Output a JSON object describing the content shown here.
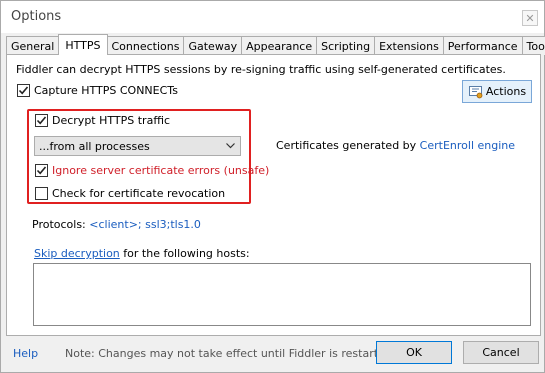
{
  "window": {
    "title": "Options"
  },
  "tabs": [
    {
      "label": "General"
    },
    {
      "label": "HTTPS"
    },
    {
      "label": "Connections"
    },
    {
      "label": "Gateway"
    },
    {
      "label": "Appearance"
    },
    {
      "label": "Scripting"
    },
    {
      "label": "Extensions"
    },
    {
      "label": "Performance"
    },
    {
      "label": "Tools"
    }
  ],
  "https": {
    "intro": "Fiddler can decrypt HTTPS sessions by re-signing traffic using self-generated certificates.",
    "capture_connects": {
      "label": "Capture HTTPS CONNECTs",
      "checked": true
    },
    "actions_label": "Actions",
    "decrypt": {
      "label": "Decrypt HTTPS traffic",
      "checked": true
    },
    "process_filter": {
      "selected": "...from all processes"
    },
    "ignore_errors": {
      "label": "Ignore server certificate errors (unsafe)",
      "checked": true
    },
    "revocation": {
      "label": "Check for certificate revocation",
      "checked": false
    },
    "certs_prefix": "Certificates generated by",
    "certs_engine": "CertEnroll engine",
    "protocols_prefix": "Protocols:",
    "protocols_value": "<client>; ssl3;tls1.0",
    "skip_link": "Skip decryption",
    "skip_suffix": "for the following hosts:",
    "hosts_value": ""
  },
  "footer": {
    "help": "Help",
    "note": "Note: Changes may not take effect until Fiddler is restarted.",
    "ok": "OK",
    "cancel": "Cancel"
  },
  "colors": {
    "highlight_frame": "#e02020",
    "link": "#1a5dbf",
    "warning_text": "#d0202a"
  }
}
